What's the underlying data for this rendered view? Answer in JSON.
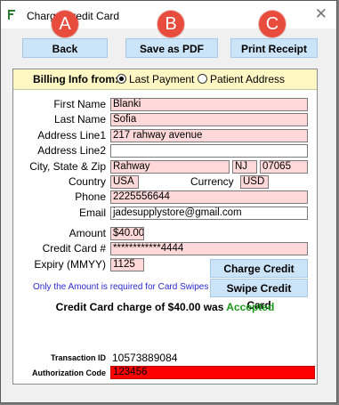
{
  "window": {
    "title": "Charge Credit Card",
    "close_symbol": "✕"
  },
  "callouts": [
    "A",
    "B",
    "C"
  ],
  "toolbar": {
    "back_label": "Back",
    "save_pdf_label": "Save as PDF",
    "print_receipt_label": "Print Receipt"
  },
  "billing": {
    "label": "Billing Info from:",
    "options": [
      {
        "label": "Last Payment",
        "selected": true
      },
      {
        "label": "Patient Address",
        "selected": false
      }
    ]
  },
  "form": {
    "first_name_label": "First Name",
    "first_name": "Blanki",
    "last_name_label": "Last Name",
    "last_name": "Sofia",
    "address1_label": "Address Line1",
    "address1": "217 rahway avenue",
    "address2_label": "Address Line2",
    "address2": "",
    "city_label": "City, State & Zip",
    "city": "Rahway",
    "state": "NJ",
    "zip": "07065",
    "country_label": "Country",
    "country": "USA",
    "currency_label": "Currency",
    "currency": "USD",
    "phone_label": "Phone",
    "phone": "2225556644",
    "email_label": "Email",
    "email": "jadesupplystore@gmail.com",
    "amount_label": "Amount",
    "amount": "$40.00",
    "card_label": "Credit Card #",
    "card": "************4444",
    "expiry_label": "Expiry (MMYY)",
    "expiry": "1125"
  },
  "actions": {
    "charge_label": "Charge Credit Card",
    "swipe_label": "Swipe Credit Card"
  },
  "note": "Only the Amount is required for Card Swipes",
  "status": {
    "prefix": "Credit Card charge of $40.00 was ",
    "result": "Accepted"
  },
  "transaction": {
    "id_label": "Transaction ID",
    "id": "10573889084",
    "auth_label": "Authorization Code",
    "auth": "123456"
  },
  "colors": {
    "accent_button": "#cce4f7",
    "required_field": "#ffd9d9",
    "billing_bar": "#fff8c4",
    "accepted": "#1a9a1a",
    "callout": "#e84c3d"
  }
}
